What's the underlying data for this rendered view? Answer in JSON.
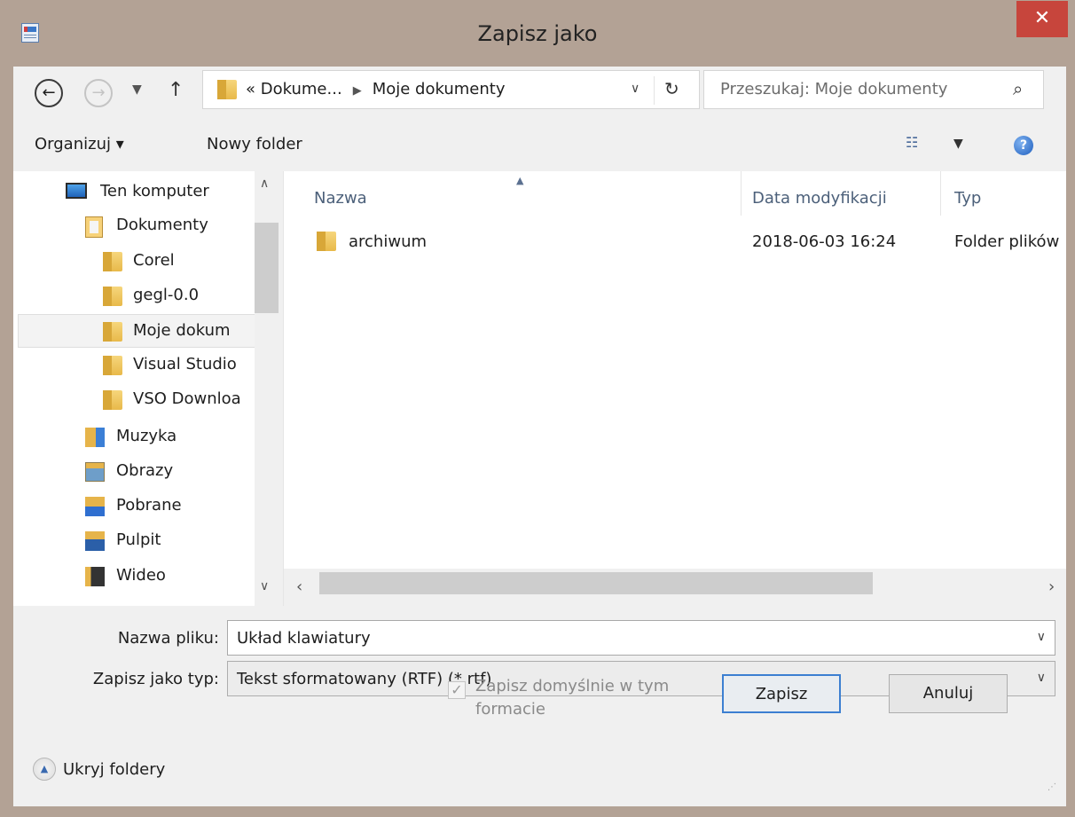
{
  "window": {
    "title": "Zapisz jako",
    "close_label": "✕"
  },
  "address_bar": {
    "overflow": "«",
    "crumb_parent": "Dokume...",
    "separator": "▶",
    "crumb_current": "Moje dokumenty",
    "dropdown_icon": "chevron-down-icon",
    "refresh_icon": "refresh-icon"
  },
  "search": {
    "placeholder": "Przeszukaj: Moje dokumenty"
  },
  "toolbar": {
    "organize_label": "Organizuj ▾",
    "new_folder_label": "Nowy folder"
  },
  "nav_pane": {
    "items": [
      {
        "label": "Ten komputer",
        "icon": "computer-icon"
      },
      {
        "label": "Dokumenty",
        "icon": "documents-folder-icon"
      },
      {
        "label": "Corel",
        "icon": "folder-icon"
      },
      {
        "label": "gegl-0.0",
        "icon": "folder-icon"
      },
      {
        "label": "Moje dokum",
        "icon": "folder-icon",
        "selected": true
      },
      {
        "label": "Visual Studio",
        "icon": "folder-icon"
      },
      {
        "label": "VSO Downloa",
        "icon": "folder-icon"
      },
      {
        "label": "Muzyka",
        "icon": "music-folder-icon"
      },
      {
        "label": "Obrazy",
        "icon": "pictures-folder-icon"
      },
      {
        "label": "Pobrane",
        "icon": "downloads-folder-icon"
      },
      {
        "label": "Pulpit",
        "icon": "desktop-folder-icon"
      },
      {
        "label": "Wideo",
        "icon": "videos-folder-icon"
      }
    ]
  },
  "file_list": {
    "columns": [
      "Nazwa",
      "Data modyfikacji",
      "Typ"
    ],
    "rows": [
      {
        "name": "archiwum",
        "modified": "2018-06-03 16:24",
        "type": "Folder plików"
      }
    ]
  },
  "form": {
    "filename_label": "Nazwa pliku:",
    "filename_value": "Układ klawiatury",
    "filetype_label": "Zapisz jako typ:",
    "filetype_value": "Tekst sformatowany (RTF) (*.rtf)",
    "default_format_label": "Zapisz domyślnie w tym formacie",
    "default_format_checked": true
  },
  "footer": {
    "hide_folders_label": "Ukryj foldery",
    "save_label": "Zapisz",
    "cancel_label": "Anuluj"
  },
  "colors": {
    "frame": "#b3a295",
    "close": "#c7453c",
    "accent": "#3c7fd1"
  }
}
